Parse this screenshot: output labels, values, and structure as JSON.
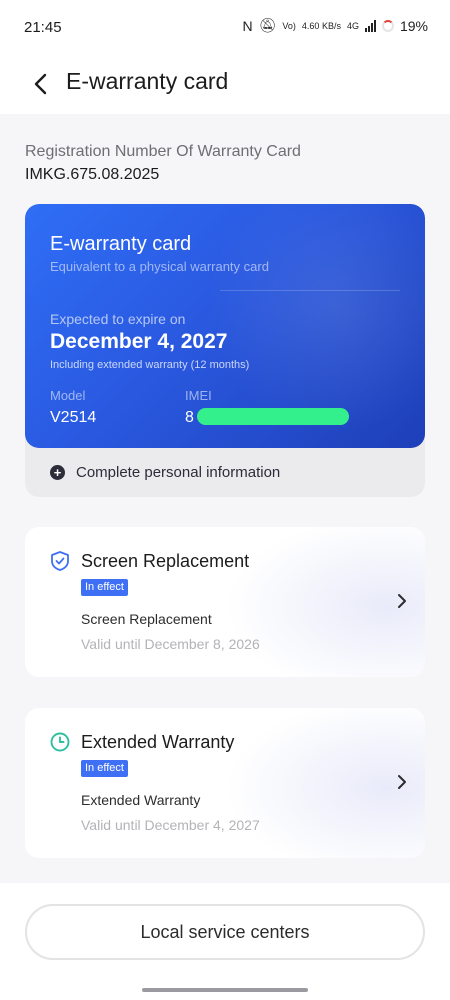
{
  "status_bar": {
    "time": "21:45",
    "network_label": "4G",
    "volte_label": "Vo)",
    "speed": "4.60",
    "speed_unit": "KB/s",
    "battery": "19%"
  },
  "header": {
    "title": "E-warranty card"
  },
  "registration": {
    "label": "Registration Number Of Warranty Card",
    "number": "IMKG.675.08.2025"
  },
  "card": {
    "title": "E-warranty card",
    "subtitle": "Equivalent to a physical warranty card",
    "expire_label": "Expected to expire on",
    "expire_date": "December 4, 2027",
    "expire_note": "Including extended warranty (12 months)",
    "model_label": "Model",
    "model_value": "V2514",
    "imei_label": "IMEI",
    "imei_visible": "8",
    "redaction_color": "#33f08c"
  },
  "complete_info": {
    "label": "Complete personal information"
  },
  "plans": [
    {
      "title": "Screen Replacement",
      "badge": "In effect",
      "name": "Screen Replacement",
      "valid": "Valid until December 8, 2026",
      "icon": "shield-check-icon"
    },
    {
      "title": "Extended Warranty",
      "badge": "In effect",
      "name": "Extended Warranty",
      "valid": "Valid until December 4, 2027",
      "icon": "clock-icon"
    }
  ],
  "footer": {
    "button_label": "Local service centers"
  },
  "colors": {
    "card_blue": "#2a59e0",
    "badge_blue": "#3f6ff5",
    "clock_teal": "#2bbfa0"
  }
}
